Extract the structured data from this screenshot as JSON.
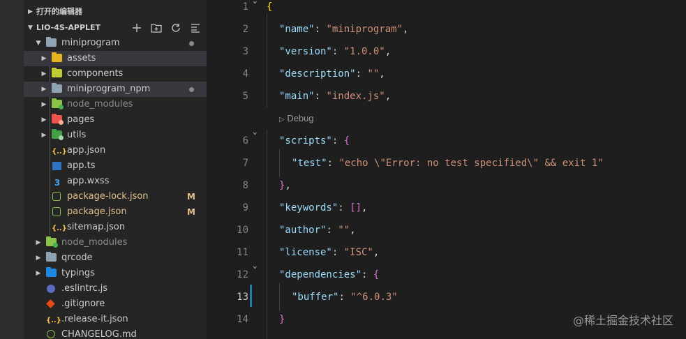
{
  "sidebar": {
    "open_editors_title": "打开的编辑器",
    "project_title": "LIO-4S-APPLET",
    "actions": [
      "new-file-icon",
      "new-folder-icon",
      "refresh-icon",
      "collapse-all-icon"
    ],
    "items": [
      {
        "label": "miniprogram",
        "kind": "folder",
        "open": true,
        "level": 0,
        "modified_dot": true
      },
      {
        "label": "assets",
        "kind": "folder",
        "level": 1
      },
      {
        "label": "components",
        "kind": "folder",
        "level": 1
      },
      {
        "label": "miniprogram_npm",
        "kind": "folder",
        "level": 1,
        "modified_dot": true
      },
      {
        "label": "node_modules",
        "kind": "folder",
        "level": 1,
        "dim": true
      },
      {
        "label": "pages",
        "kind": "folder",
        "level": 1
      },
      {
        "label": "utils",
        "kind": "folder",
        "level": 1
      },
      {
        "label": "app.json",
        "kind": "json",
        "level": 1
      },
      {
        "label": "app.ts",
        "kind": "ts",
        "level": 1
      },
      {
        "label": "app.wxss",
        "kind": "css",
        "level": 1
      },
      {
        "label": "package-lock.json",
        "kind": "npm",
        "level": 1,
        "badge": "M"
      },
      {
        "label": "package.json",
        "kind": "npm",
        "level": 1,
        "badge": "M"
      },
      {
        "label": "sitemap.json",
        "kind": "json",
        "level": 1
      },
      {
        "label": "node_modules",
        "kind": "folder",
        "level": 0,
        "dim": true
      },
      {
        "label": "qrcode",
        "kind": "folder",
        "level": 0
      },
      {
        "label": "typings",
        "kind": "folder",
        "level": 0
      },
      {
        "label": ".eslintrc.js",
        "kind": "eslint",
        "level": 0
      },
      {
        "label": ".gitignore",
        "kind": "git",
        "level": 0
      },
      {
        "label": ".release-it.json",
        "kind": "json",
        "level": 0
      },
      {
        "label": "CHANGELOG.md",
        "kind": "changelog",
        "level": 0
      }
    ]
  },
  "editor": {
    "line_numbers": [
      "1",
      "2",
      "3",
      "4",
      "5",
      "6",
      "7",
      "8",
      "9",
      "10",
      "11",
      "12",
      "13",
      "14"
    ],
    "codelens": "Debug",
    "lines": {
      "l1": "{",
      "l2_key": "\"name\"",
      "l2_val": "\"miniprogram\"",
      "l3_key": "\"version\"",
      "l3_val": "\"1.0.0\"",
      "l4_key": "\"description\"",
      "l4_val": "\"\"",
      "l5_key": "\"main\"",
      "l5_val": "\"index.js\"",
      "l6_key": "\"scripts\"",
      "l6_open": "{",
      "l7_key": "\"test\"",
      "l7_val": "\"echo \\\"Error: no test specified\\\" && exit 1\"",
      "l8_close": "}",
      "l9_key": "\"keywords\"",
      "l9_val": "[]",
      "l10_key": "\"author\"",
      "l10_val": "\"\"",
      "l11_key": "\"license\"",
      "l11_val": "\"ISC\"",
      "l12_key": "\"dependencies\"",
      "l12_open": "{",
      "l13_key": "\"buffer\"",
      "l13_val": "\"^6.0.3\"",
      "l14_close": "}"
    }
  },
  "watermark": "@稀土掘金技术社区"
}
